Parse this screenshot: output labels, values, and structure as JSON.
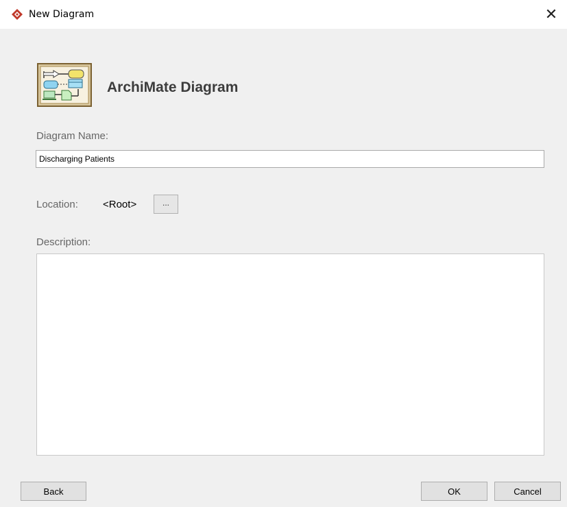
{
  "window": {
    "title": "New Diagram",
    "close_glyph": "✕",
    "app_icon": "visual-paradigm-diamond-icon"
  },
  "header": {
    "icon": "archimate-diagram-icon",
    "title": "ArchiMate Diagram"
  },
  "form": {
    "name_label": "Diagram Name:",
    "name_value": "Discharging Patients",
    "location_label": "Location:",
    "location_value": "<Root>",
    "browse_label": "...",
    "description_label": "Description:",
    "description_value": ""
  },
  "buttons": {
    "back": "Back",
    "ok": "OK",
    "cancel": "Cancel"
  },
  "colors": {
    "accent_red": "#c0392b",
    "dialog_bg": "#f0f0f0"
  }
}
